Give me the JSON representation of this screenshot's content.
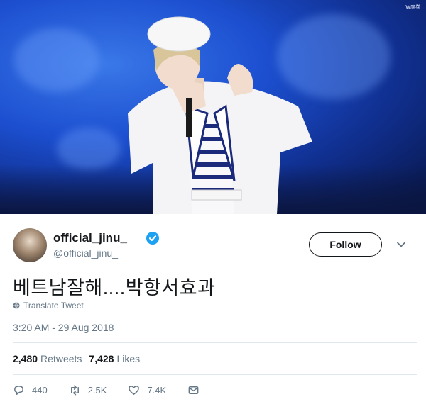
{
  "photo": {
    "watermark": "W席卷"
  },
  "tweet": {
    "display_name": "official_jinu_",
    "handle": "@official_jinu_",
    "follow_label": "Follow",
    "text": "베트남잘해....박항서효과",
    "translate_label": "Translate Tweet",
    "timestamp": "3:20 AM - 29 Aug 2018",
    "stats": {
      "retweets_count": "2,480",
      "retweets_label": "Retweets",
      "likes_count": "7,428",
      "likes_label": "Likes"
    },
    "actions": {
      "reply_count": "440",
      "retweet_count": "2.5K",
      "like_count": "7.4K"
    }
  },
  "colors": {
    "accent": "#1da1f2",
    "text": "#14171a",
    "muted": "#657786",
    "divider": "#e1e8ed"
  },
  "icons": [
    "verified-icon",
    "chevron-down-icon",
    "globe-icon",
    "reply-icon",
    "retweet-icon",
    "like-icon",
    "message-icon"
  ]
}
